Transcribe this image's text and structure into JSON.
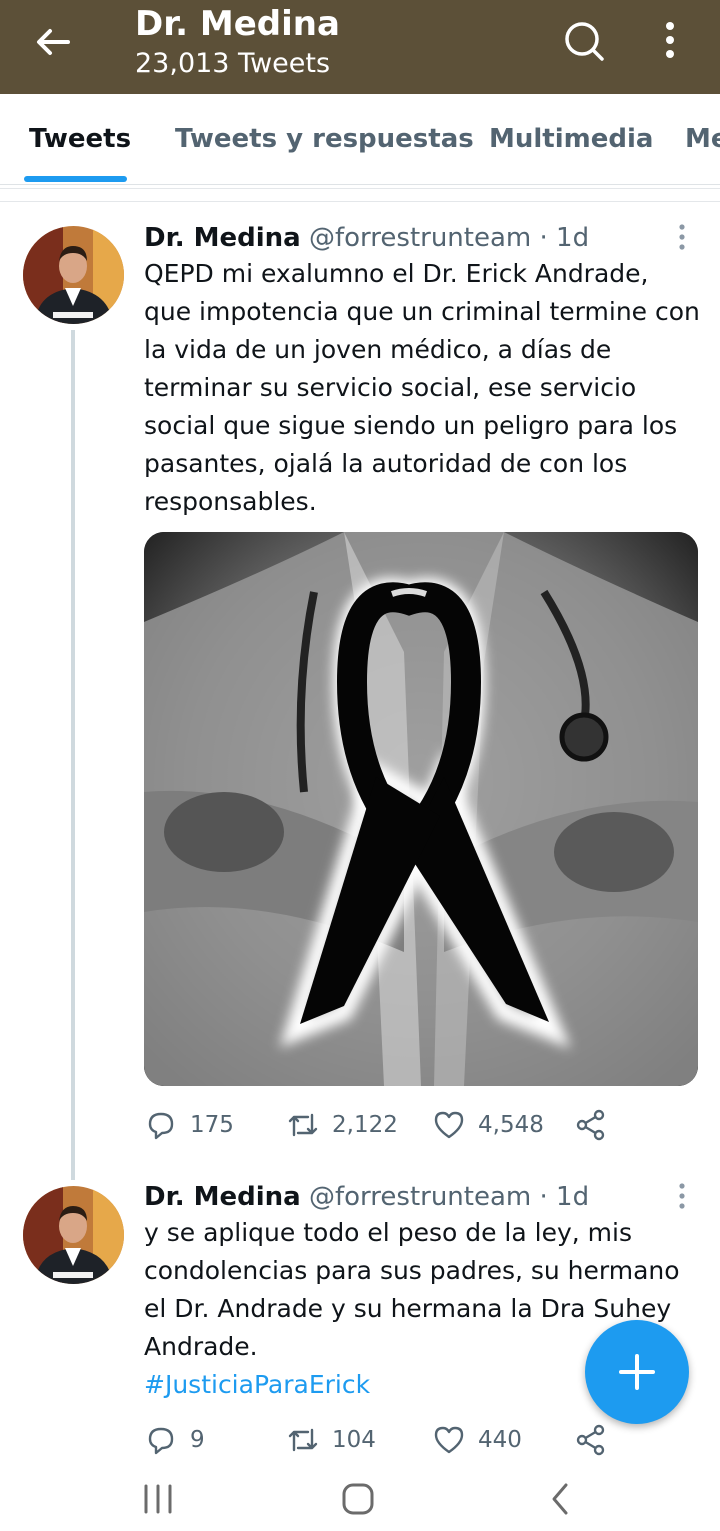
{
  "header": {
    "title": "Dr. Medina",
    "subtitle": "23,013 Tweets",
    "bg_color": "#5c5038",
    "icons": [
      "back-arrow-icon",
      "search-icon",
      "more-vertical-icon"
    ]
  },
  "tabs": [
    {
      "label": "Tweets",
      "active": true
    },
    {
      "label": "Tweets y respuestas",
      "active": false
    },
    {
      "label": "Multimedia",
      "active": false
    },
    {
      "label": "Me",
      "active": false
    }
  ],
  "accent_color": "#1d9bf0",
  "tweets": [
    {
      "name": "Dr. Medina",
      "handle": "@forrestrunteam",
      "time": "· 1d",
      "text": "QEPD mi exalumno el Dr. Erick Andrade,\nque impotencia que un criminal termine con\nla vida de un joven médico, a días de\nterminar su servicio social, ese servicio\nsocial que sigue siendo un peligro para los\npasantes, ojalá la autoridad de con los\nresponsables.",
      "media": "black-mourning-ribbon-over-doctor-in-lab-coat",
      "replies": "175",
      "retweets": "2,122",
      "likes": "4,548"
    },
    {
      "name": "Dr. Medina",
      "handle": "@forrestrunteam",
      "time": "· 1d",
      "text": "y se aplique todo el peso de la ley, mis\ncondolencias para sus padres, su hermano\nel Dr. Andrade y su hermana la Dra Suhey\nAndrade.",
      "hashtag": "#JusticiaParaErick",
      "replies": "9",
      "retweets": "104",
      "likes": "440"
    }
  ],
  "fab": {
    "icon": "plus-icon"
  },
  "system_nav": {
    "icons": [
      "recent-apps-icon",
      "home-icon",
      "back-icon"
    ]
  }
}
